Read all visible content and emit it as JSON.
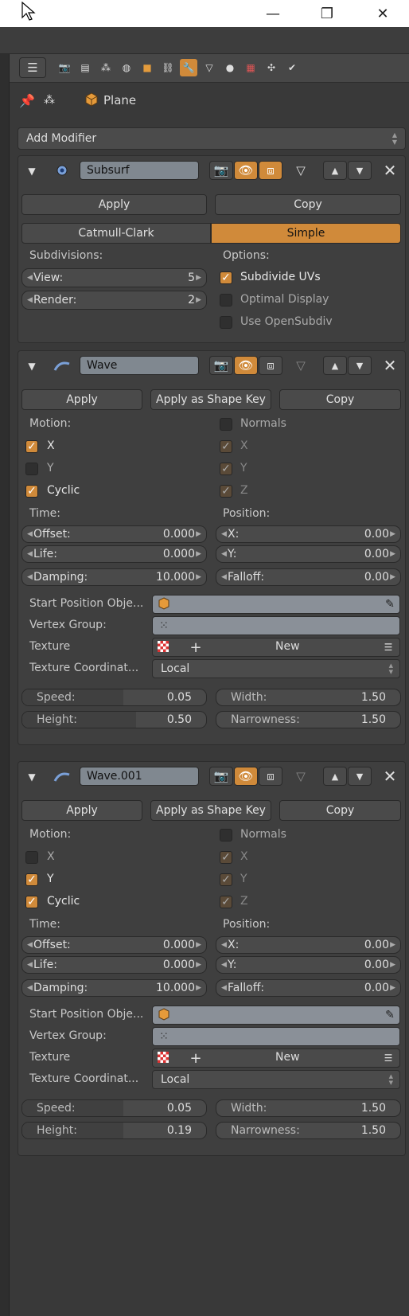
{
  "window": {
    "minimize": "—",
    "maximize": "❐",
    "close": "✕"
  },
  "breadcrumb": {
    "object": "Plane"
  },
  "add_modifier": "Add Modifier",
  "subsurf": {
    "name": "Subsurf",
    "apply": "Apply",
    "copy": "Copy",
    "catmull": "Catmull-Clark",
    "simple": "Simple",
    "subdivisions_label": "Subdivisions:",
    "view_label": "View:",
    "view_value": "5",
    "render_label": "Render:",
    "render_value": "2",
    "options_label": "Options:",
    "subdivide_uvs": "Subdivide UVs",
    "optimal_display": "Optimal Display",
    "use_opensubdiv": "Use OpenSubdiv"
  },
  "wave1": {
    "name": "Wave",
    "apply": "Apply",
    "apply_shape": "Apply as Shape Key",
    "copy": "Copy",
    "motion_label": "Motion:",
    "x": "X",
    "y": "Y",
    "cyclic": "Cyclic",
    "normals": "Normals",
    "nx": "X",
    "ny": "Y",
    "nz": "Z",
    "time_label": "Time:",
    "position_label": "Position:",
    "offset_label": "Offset:",
    "offset": "0.000",
    "life_label": "Life:",
    "life": "0.000",
    "damping_label": "Damping:",
    "damping": "10.000",
    "px_label": "X:",
    "px": "0.00",
    "py_label": "Y:",
    "py": "0.00",
    "falloff_label": "Falloff:",
    "falloff": "0.00",
    "start_pos": "Start Position Obje...",
    "vertex_group": "Vertex Group:",
    "texture": "Texture",
    "new": "New",
    "tex_coord": "Texture Coordinat...",
    "tex_coord_val": "Local",
    "speed_label": "Speed:",
    "speed": "0.05",
    "width_label": "Width:",
    "width": "1.50",
    "height_label": "Height:",
    "height": "0.50",
    "narrow_label": "Narrowness:",
    "narrow": "1.50"
  },
  "wave2": {
    "name": "Wave.001",
    "apply": "Apply",
    "apply_shape": "Apply as Shape Key",
    "copy": "Copy",
    "motion_label": "Motion:",
    "x": "X",
    "y": "Y",
    "cyclic": "Cyclic",
    "normals": "Normals",
    "nx": "X",
    "ny": "Y",
    "nz": "Z",
    "time_label": "Time:",
    "position_label": "Position:",
    "offset_label": "Offset:",
    "offset": "0.000",
    "life_label": "Life:",
    "life": "0.000",
    "damping_label": "Damping:",
    "damping": "10.000",
    "px_label": "X:",
    "px": "0.00",
    "py_label": "Y:",
    "py": "0.00",
    "falloff_label": "Falloff:",
    "falloff": "0.00",
    "start_pos": "Start Position Obje...",
    "vertex_group": "Vertex Group:",
    "texture": "Texture",
    "new": "New",
    "tex_coord": "Texture Coordinat...",
    "tex_coord_val": "Local",
    "speed_label": "Speed:",
    "speed": "0.05",
    "width_label": "Width:",
    "width": "1.50",
    "height_label": "Height:",
    "height": "0.19",
    "narrow_label": "Narrowness:",
    "narrow": "1.50"
  },
  "colors": {
    "accent": "#d08a3a",
    "panel": "#3f3f3f",
    "background": "#393939"
  }
}
